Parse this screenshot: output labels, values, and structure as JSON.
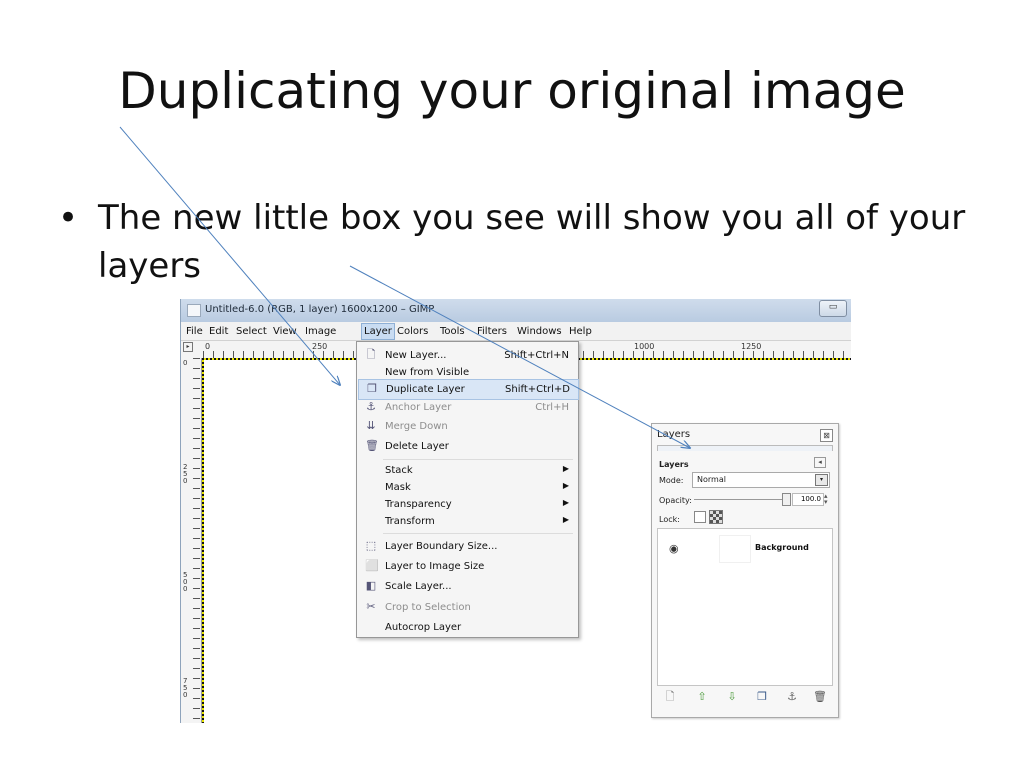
{
  "slide": {
    "title": "Duplicating your original image",
    "bullet_symbol": "•",
    "bullet_text": "The new little box you see will show you all of your layers"
  },
  "gimp_window": {
    "title": "Untitled-6.0 (RGB, 1 layer) 1600x1200 – GIMP",
    "minimize_symbol": "▭",
    "menubar": [
      "File",
      "Edit",
      "Select",
      "View",
      "Image",
      "Layer",
      "Colors",
      "Tools",
      "Filters",
      "Windows",
      "Help"
    ],
    "active_menu": "Layer",
    "ruler_top_labels": [
      "0",
      "250",
      "1000",
      "1250"
    ],
    "ruler_left_labels": [
      "0",
      "250",
      "500",
      "750"
    ]
  },
  "layer_menu": {
    "items": [
      {
        "icon": "new-layer-icon",
        "label": "New Layer...",
        "shortcut": "Shift+Ctrl+N",
        "disabled": false
      },
      {
        "icon": "",
        "label": "New from Visible",
        "shortcut": "",
        "disabled": false
      },
      {
        "icon": "duplicate-layer-icon",
        "label": "Duplicate Layer",
        "shortcut": "Shift+Ctrl+D",
        "disabled": false,
        "highlighted": true
      },
      {
        "icon": "anchor-icon",
        "label": "Anchor Layer",
        "shortcut": "Ctrl+H",
        "disabled": true
      },
      {
        "icon": "merge-down-icon",
        "label": "Merge Down",
        "shortcut": "",
        "disabled": true
      },
      {
        "icon": "delete-icon",
        "label": "Delete Layer",
        "shortcut": "",
        "disabled": false
      },
      {
        "icon": "",
        "label": "Stack",
        "submenu": true
      },
      {
        "icon": "",
        "label": "Mask",
        "submenu": true
      },
      {
        "icon": "",
        "label": "Transparency",
        "submenu": true
      },
      {
        "icon": "",
        "label": "Transform",
        "submenu": true
      },
      {
        "icon": "layer-boundary-icon",
        "label": "Layer Boundary Size...",
        "shortcut": "",
        "disabled": false
      },
      {
        "icon": "layer-to-image-icon",
        "label": "Layer to Image Size",
        "shortcut": "",
        "disabled": false
      },
      {
        "icon": "scale-layer-icon",
        "label": "Scale Layer...",
        "shortcut": "",
        "disabled": false
      },
      {
        "icon": "crop-icon",
        "label": "Crop to Selection",
        "shortcut": "",
        "disabled": true
      },
      {
        "icon": "",
        "label": "Autocrop Layer",
        "shortcut": "",
        "disabled": false
      }
    ],
    "submenu_arrow": "▶"
  },
  "layers_dock": {
    "title": "Layers",
    "close_symbol": "⊠",
    "heading": "Layers",
    "collapse_symbol": "◂",
    "mode_label": "Mode:",
    "mode_value": "Normal",
    "mode_btn": "▾",
    "opacity_label": "Opacity:",
    "opacity_value": "100.0",
    "opacity_fraction": 1.0,
    "lock_label": "Lock:",
    "layers": [
      {
        "name": "Background",
        "visible": true
      }
    ],
    "eye_symbol": "👁",
    "buttons": [
      {
        "name": "new-layer-button",
        "glyph": "🗋"
      },
      {
        "name": "raise-layer-button",
        "glyph": "⇧"
      },
      {
        "name": "lower-layer-button",
        "glyph": "⇩"
      },
      {
        "name": "duplicate-layer-button",
        "glyph": "❐"
      },
      {
        "name": "anchor-layer-button",
        "glyph": "⚓"
      },
      {
        "name": "delete-layer-button",
        "glyph": "🗑"
      }
    ]
  },
  "colors": {
    "arrow": "#4f81bd",
    "menu_highlight": "#d9e6f6"
  }
}
